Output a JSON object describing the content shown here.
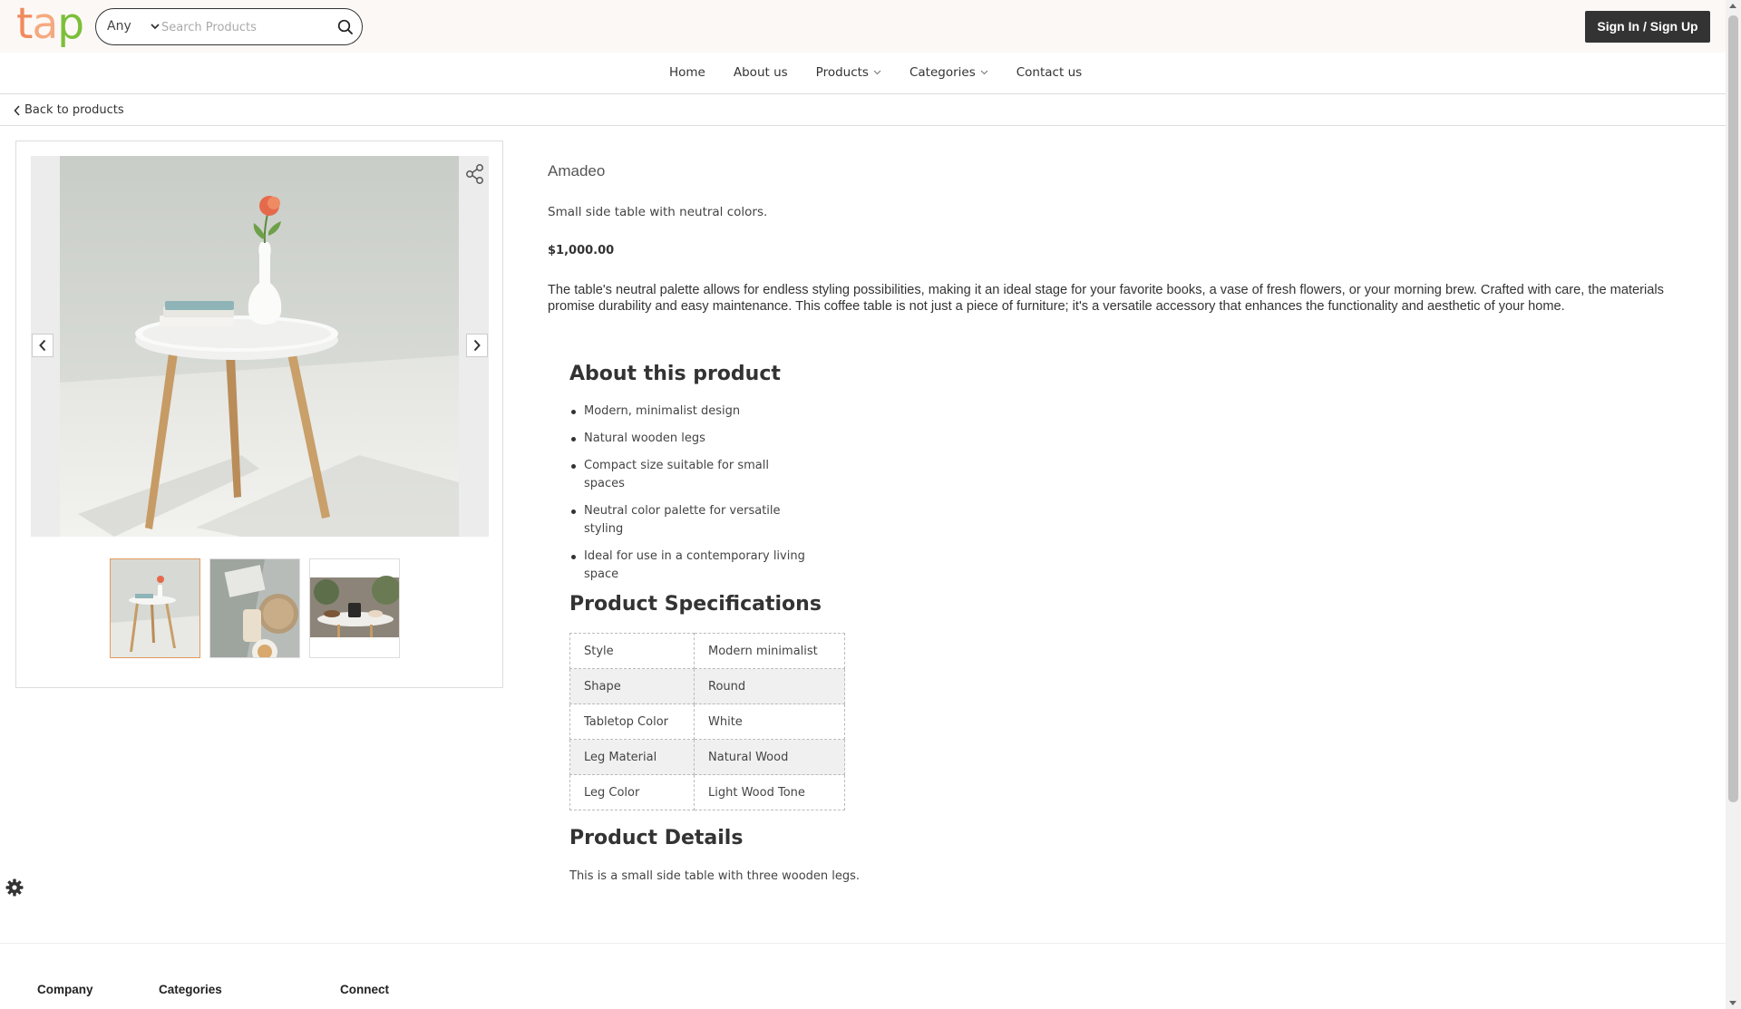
{
  "header": {
    "logo": [
      "t",
      "a",
      "p"
    ],
    "search": {
      "category": "Any",
      "placeholder": "Search Products"
    },
    "signin_label": "Sign In / Sign Up"
  },
  "nav": {
    "home": "Home",
    "about": "About us",
    "products": "Products",
    "categories": "Categories",
    "contact": "Contact us"
  },
  "back_label": "Back to products",
  "product": {
    "name": "Amadeo",
    "short_description": "Small side table with neutral colors.",
    "price": "$1,000.00",
    "long_description": "The table's neutral palette allows for endless styling possibilities, making it an ideal stage for your favorite books, a vase of fresh flowers, or your morning brew. Crafted with care, the materials promise durability and easy maintenance. This coffee table is not just a piece of furniture; it's a versatile accessory that enhances the functionality and aesthetic of your home.",
    "about_title": "About this product",
    "features": [
      "Modern, minimalist design",
      "Natural wooden legs",
      "Compact size suitable for small spaces",
      "Neutral color palette for versatile styling",
      "Ideal for use in a contemporary living space"
    ],
    "specs_title": "Product Specifications",
    "specs": [
      {
        "key": "Style",
        "value": "Modern minimalist"
      },
      {
        "key": "Shape",
        "value": "Round"
      },
      {
        "key": "Tabletop Color",
        "value": "White"
      },
      {
        "key": "Leg Material",
        "value": "Natural Wood"
      },
      {
        "key": "Leg Color",
        "value": "Light Wood Tone"
      }
    ],
    "details_title": "Product Details",
    "details": "This is a small side table with three wooden legs."
  },
  "footer": {
    "company": "Company",
    "categories": "Categories",
    "connect": "Connect"
  },
  "colors": {
    "logo_t": "#f08a5d",
    "logo_a": "#f5a97f",
    "logo_p": "#7cbf3a",
    "signin_bg": "#333333",
    "active_thumb_border": "#e49a5c"
  }
}
